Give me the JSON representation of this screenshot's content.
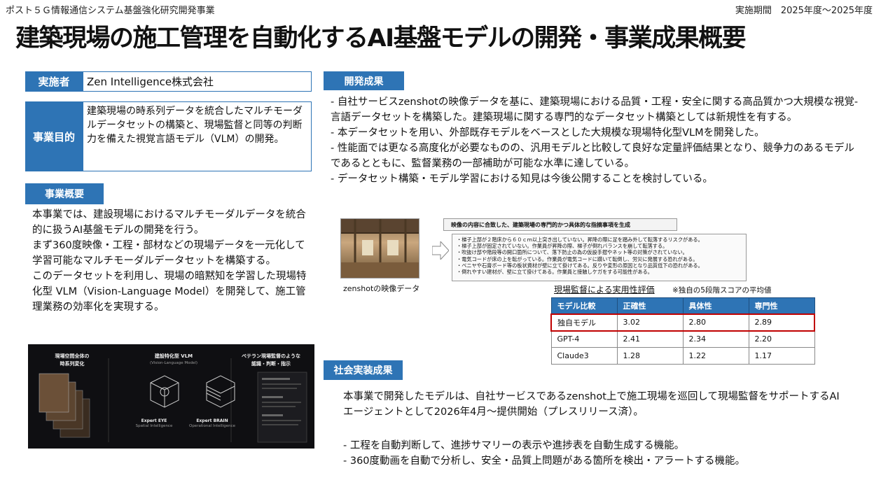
{
  "header": {
    "program": "ポスト５Ｇ情報通信システム基盤強化研究開発事業",
    "period": "実施期間　2025年度～2025年度",
    "title": "建築現場の施工管理を自動化するAI基盤モデルの開発・事業成果概要"
  },
  "implementer": {
    "label": "実施者",
    "value": "Zen Intelligence株式会社"
  },
  "purpose": {
    "label": "事業目的",
    "value": "建築現場の時系列データを統合したマルチモーダルデータセットの構築と、現場監督と同等の判断力を備えた視覚言語モデル（VLM）の開発。"
  },
  "overview": {
    "label": "事業概要",
    "paragraphs": [
      "本事業では、建設現場におけるマルチモーダルデータを統合的に扱うAI基盤モデルの開発を行う。",
      "まず360度映像・工程・部材などの現場データを一元化して学習可能なマルチモーダルデータセットを構築する。",
      "このデータセットを利用し、現場の暗黙知を学習した現場特化型 VLM（Vision-Language Model）を開発して、施工管理業務の効率化を実現する。"
    ]
  },
  "workflow_figure": {
    "col1_title": "現場空間全体の\n時系列変化",
    "col2_title": "建設特化型 VLM",
    "col2_sub": "(Vision-Language Model)",
    "col3_title": "ベテラン現場監督のような\n認識・判断・指示",
    "eye_title": "Expert EYE",
    "eye_sub": "Spatial Intelligence",
    "brain_title": "Expert BRAIN",
    "brain_sub": "Operational Intelligence"
  },
  "results": {
    "label": "開発成果",
    "items": [
      "- 自社サービスzenshotの映像データを基に、建築現場における品質・工程・安全に関する高品質かつ大規模な視覚-言語データセットを構築した。建築現場に関する専門的なデータセット構築としては新規性を有する。",
      "- 本データセットを用い、外部既存モデルをベースとした大規模な現場特化型VLMを開発した。",
      "- 性能面では更なる高度化が必要なものの、汎用モデルと比較して良好な定量評価結果となり、競争力のあるモデルであるとともに、監督業務の一部補助が可能な水準に達している。",
      "- データセット構築・モデル学習における知見は今後公開することを検討している。"
    ]
  },
  "figure": {
    "photo_caption": "zenshotの映像データ",
    "panel_header": "映像の内容に合致した、建築現場の専門的かつ具体的な指摘事項を生成",
    "panel_items": [
      "・梯子上部が２階床から６０ｃｍ以上突き出していない。昇降の際に足を踏み外して転落するリスクがある。",
      "・梯子上部が固定されていない。作業員が昇降の際、梯子が倒れバランスを崩して転落する。",
      "・吹抜け部や階段等の開口箇所について、落下防止の為の仮設手摺やネット等の対策がされていない。",
      "・電気コードが床の上を転がっている。作業員が電気コードに躓いて転倒し、労災に発展する恐れがある。",
      "・ベニヤや石膏ボード等の板状資材が壁に立て掛けてある。反りや変形の原因となり品質低下の恐れがある。",
      "・倒れやすい建材が、壁に立て掛けてある。作業員と接触しケガをする可能性がある。"
    ]
  },
  "evaluation": {
    "title": "現場監督による実用性評価",
    "note": "※独自の5段階スコアの平均値",
    "headers": [
      "モデル比較",
      "正確性",
      "具体性",
      "専門性"
    ],
    "rows": [
      [
        "独自モデル",
        "3.02",
        "2.80",
        "2.89"
      ],
      [
        "GPT-4",
        "2.41",
        "2.34",
        "2.20"
      ],
      [
        "Claude3",
        "1.28",
        "1.22",
        "1.17"
      ]
    ],
    "highlight_color": "#c00000"
  },
  "social": {
    "label": "社会実装成果",
    "text": "本事業で開発したモデルは、自社サービスであるzenshot上で施工現場を巡回して現場監督をサポートするAIエージェントとして2026年4月～提供開始（プレスリリース済）。",
    "items": [
      "- 工程を自動判断して、進捗サマリーの表示や進捗表を自動生成する機能。",
      "- 360度動画を自動で分析し、安全・品質上問題がある箇所を検出・アラートする機能。"
    ]
  },
  "colors": {
    "accent": "#2e74b5",
    "highlight": "#c00000"
  }
}
